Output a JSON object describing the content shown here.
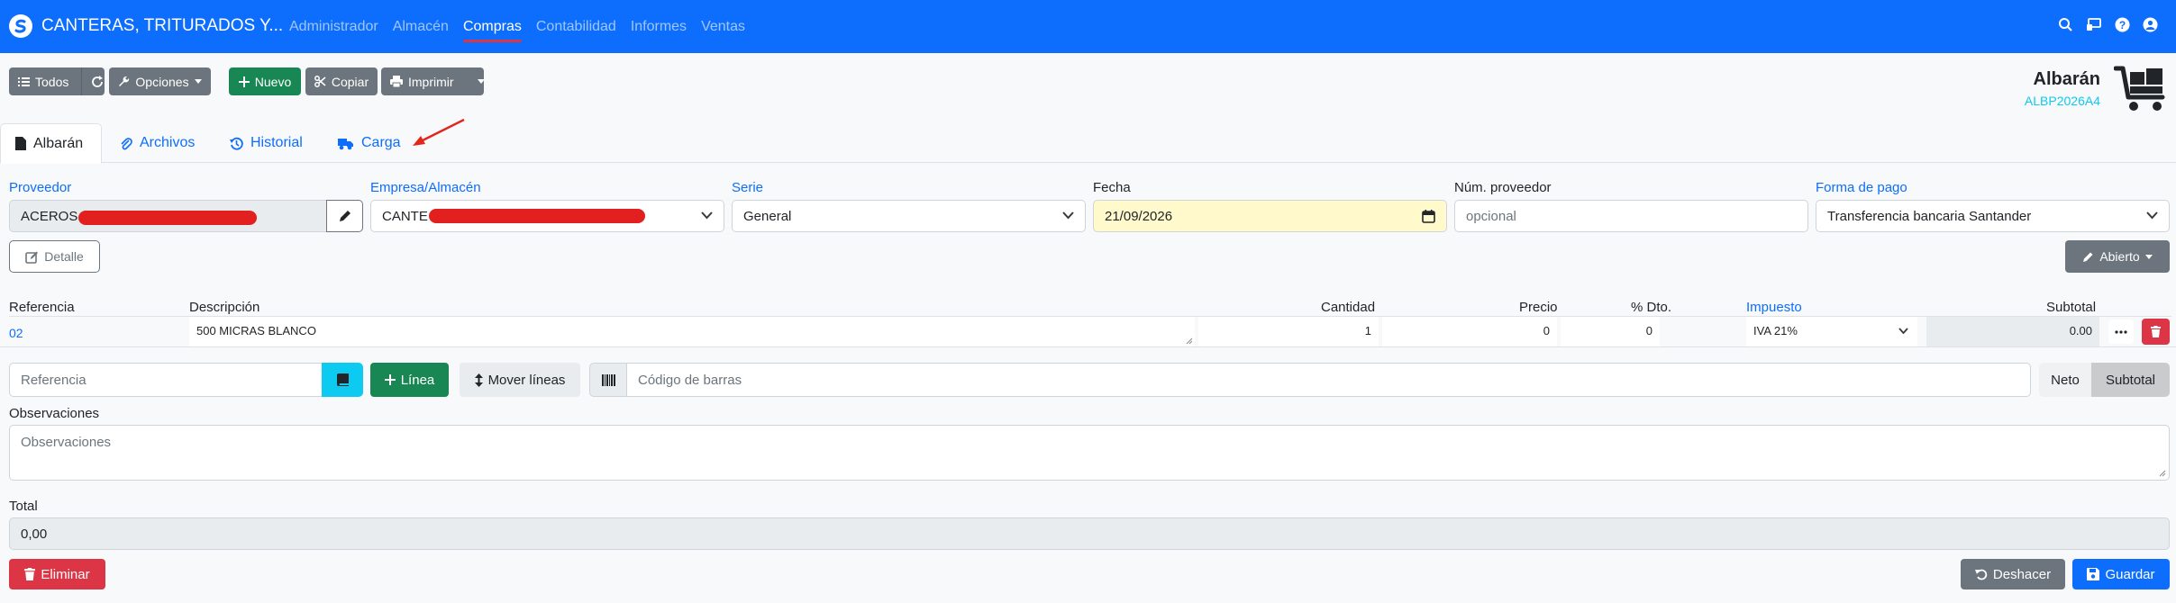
{
  "navbar": {
    "brand": "CANTERAS, TRITURADOS Y...",
    "menu": [
      "Administrador",
      "Almacén",
      "Compras",
      "Contabilidad",
      "Informes",
      "Ventas"
    ],
    "active_menu": "Compras"
  },
  "toolbar": {
    "all_label": "Todos",
    "options_label": "Opciones",
    "new_label": "Nuevo",
    "copy_label": "Copiar",
    "print_label": "Imprimir"
  },
  "document": {
    "type": "Albarán",
    "code": "ALBP2026A4"
  },
  "tabs": [
    "Albarán",
    "Archivos",
    "Historial",
    "Carga"
  ],
  "form": {
    "supplier_label": "Proveedor",
    "supplier_value": "ACEROS",
    "company_label": "Empresa/Almacén",
    "company_value": "CANTE",
    "series_label": "Serie",
    "series_value": "General",
    "date_label": "Fecha",
    "date_value": "21/09/2026",
    "supplier_num_label": "Núm. proveedor",
    "supplier_num_placeholder": "opcional",
    "payment_label": "Forma de pago",
    "payment_value": "Transferencia bancaria Santander"
  },
  "detail_button": "Detalle",
  "status_button": "Abierto",
  "lines": {
    "headers": {
      "reference": "Referencia",
      "description": "Descripción",
      "quantity": "Cantidad",
      "price": "Precio",
      "discount": "% Dto.",
      "tax": "Impuesto",
      "subtotal": "Subtotal"
    },
    "rows": [
      {
        "reference": "02",
        "description": "500 MICRAS BLANCO",
        "quantity": "1",
        "price": "0",
        "discount": "0",
        "tax": "IVA 21%",
        "subtotal": "0.00"
      }
    ]
  },
  "add_line": {
    "reference_placeholder": "Referencia",
    "line_button": "Línea",
    "move_button": "Mover líneas",
    "barcode_placeholder": "Código de barras",
    "neto_label": "Neto",
    "subtotal_label": "Subtotal"
  },
  "observations": {
    "label": "Observaciones",
    "placeholder": "Observaciones"
  },
  "total": {
    "label": "Total",
    "value": "0,00"
  },
  "footer": {
    "delete_label": "Eliminar",
    "undo_label": "Deshacer",
    "save_label": "Guardar"
  },
  "colors": {
    "primary": "#0d6efd",
    "success": "#198754",
    "danger": "#dc3545",
    "secondary": "#6c757d",
    "info": "#0dcaf0",
    "date_bg": "#fff9cc"
  },
  "icons": [
    "list-icon",
    "refresh-icon",
    "wrench-icon",
    "plus-icon",
    "scissors-icon",
    "printer-icon",
    "truck-icon",
    "file-icon",
    "paperclip-icon",
    "history-icon",
    "cart-icon",
    "pencil-icon",
    "edit-icon",
    "book-icon",
    "arrows-vertical-icon",
    "barcode-icon",
    "trash-icon",
    "undo-icon",
    "save-icon",
    "search-icon",
    "monitor-icon",
    "help-icon",
    "user-icon"
  ]
}
